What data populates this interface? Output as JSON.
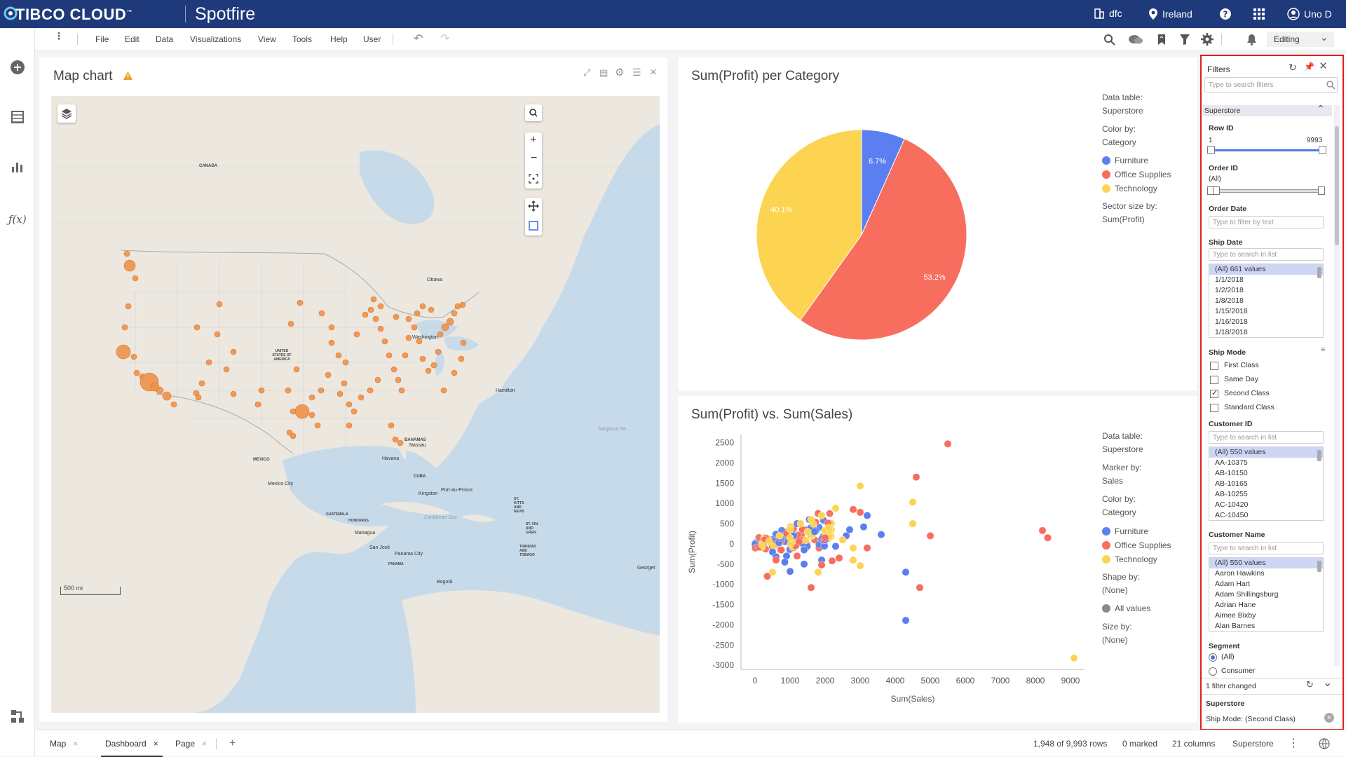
{
  "topbar": {
    "brand": "TIBCO CLOUD",
    "brand_mark": "™",
    "app": "Spotfire",
    "org": "dfc",
    "region": "Ireland",
    "user": "Uno D"
  },
  "menu": {
    "items": [
      "File",
      "Edit",
      "Data",
      "Visualizations",
      "View",
      "Tools",
      "Help",
      "User"
    ],
    "mode": "Editing"
  },
  "map": {
    "title": "Map chart",
    "scale_label": "500 mi",
    "places": [
      "CANADA",
      "UNITED STATES OF AMERICA",
      "MEXICO",
      "Ottawa",
      "Washington",
      "Hamilton",
      "Sargasso Se",
      "BAHAMAS",
      "Nassau",
      "Havana",
      "CUBA",
      "Port-au-Prince",
      "Kingston",
      "Mexico City",
      "GUATEMALA",
      "HONDURAS",
      "Managua",
      "San José",
      "PANAMA",
      "Panama City",
      "Caribbean Sea",
      "Bogotá",
      "Georget",
      "ST. KITTS AND NEVIS",
      "ST. VIN. AND GREN.",
      "TRINIDAD AND TOBAGO"
    ]
  },
  "pie": {
    "title": "Sum(Profit) per Category",
    "legend": {
      "data_table_label": "Data table:",
      "data_table": "Superstore",
      "color_by_label": "Color by:",
      "color_by": "Category",
      "sector_label": "Sector size by:",
      "sector": "Sum(Profit)"
    }
  },
  "scatter": {
    "title": "Sum(Profit) vs. Sum(Sales)",
    "legend": {
      "data_table_label": "Data table:",
      "data_table": "Superstore",
      "marker_label": "Marker by:",
      "marker": "Sales",
      "color_by_label": "Color by:",
      "color_by": "Category",
      "shape_label": "Shape by:",
      "shape": "(None)",
      "shape_item": "All values",
      "size_label": "Size by:",
      "size": "(None)"
    }
  },
  "chart_data": [
    {
      "type": "pie",
      "title": "Sum(Profit) per Category",
      "categories": [
        "Furniture",
        "Office Supplies",
        "Technology"
      ],
      "values": [
        6.7,
        53.2,
        40.1
      ],
      "labels": [
        "6.7%",
        "53.2%",
        "40.1%"
      ],
      "colors": [
        "#5b7ff0",
        "#f76d5e",
        "#fdd451"
      ],
      "legend": "right"
    },
    {
      "type": "scatter",
      "title": "Sum(Profit) vs. Sum(Sales)",
      "xlabel": "Sum(Sales)",
      "ylabel": "Sum(Profit)",
      "xlim": [
        -400,
        9400
      ],
      "ylim": [
        -3100,
        2700
      ],
      "xticks": [
        0,
        1000,
        2000,
        3000,
        4000,
        5000,
        6000,
        7000,
        8000,
        9000
      ],
      "yticks": [
        2500,
        2000,
        1500,
        1000,
        500,
        0,
        -500,
        -1000,
        -1500,
        -2000,
        -2500,
        -3000
      ],
      "series": [
        {
          "name": "Furniture",
          "color": "#5b7ff0",
          "points": [
            [
              100,
              -50
            ],
            [
              300,
              80
            ],
            [
              500,
              -200
            ],
            [
              700,
              150
            ],
            [
              900,
              -300
            ],
            [
              1100,
              200
            ],
            [
              1400,
              -150
            ],
            [
              1700,
              300
            ],
            [
              2000,
              100
            ],
            [
              2300,
              -60
            ],
            [
              2700,
              350
            ],
            [
              3100,
              420
            ],
            [
              3600,
              230
            ],
            [
              4300,
              -700
            ],
            [
              4500,
              500
            ],
            [
              4300,
              -1890
            ],
            [
              850,
              -450
            ],
            [
              1400,
              -500
            ],
            [
              1900,
              -400
            ],
            [
              1000,
              -680
            ],
            [
              3200,
              700
            ],
            [
              2600,
              200
            ],
            [
              1550,
              600
            ],
            [
              600,
              -320
            ],
            [
              1200,
              500
            ]
          ]
        },
        {
          "name": "Office Supplies",
          "color": "#f76d5e",
          "points": [
            [
              120,
              -80
            ],
            [
              280,
              100
            ],
            [
              600,
              -400
            ],
            [
              900,
              250
            ],
            [
              1200,
              -300
            ],
            [
              1600,
              -1080
            ],
            [
              2800,
              850
            ],
            [
              3000,
              780
            ],
            [
              4600,
              1650
            ],
            [
              5500,
              2470
            ],
            [
              5000,
              200
            ],
            [
              4700,
              -1080
            ],
            [
              8200,
              330
            ],
            [
              8350,
              150
            ],
            [
              1800,
              750
            ],
            [
              2000,
              150
            ],
            [
              2400,
              -350
            ],
            [
              3200,
              -100
            ],
            [
              350,
              -800
            ],
            [
              750,
              -150
            ],
            [
              1350,
              350
            ],
            [
              1900,
              -520
            ],
            [
              2200,
              -420
            ]
          ]
        },
        {
          "name": "Technology",
          "color": "#fdd451",
          "points": [
            [
              200,
              -30
            ],
            [
              400,
              60
            ],
            [
              700,
              200
            ],
            [
              1000,
              350
            ],
            [
              1300,
              500
            ],
            [
              1600,
              600
            ],
            [
              1900,
              700
            ],
            [
              2300,
              880
            ],
            [
              3000,
              1430
            ],
            [
              4500,
              1030
            ],
            [
              4500,
              500
            ],
            [
              3000,
              -540
            ],
            [
              2800,
              -400
            ],
            [
              9100,
              -2820
            ],
            [
              500,
              -700
            ],
            [
              1000,
              150
            ],
            [
              1500,
              300
            ],
            [
              2100,
              400
            ],
            [
              2500,
              100
            ],
            [
              1800,
              -700
            ],
            [
              2800,
              -100
            ]
          ]
        }
      ]
    }
  ],
  "filters": {
    "title": "Filters",
    "search_placeholder": "Type to search filters",
    "table_name": "Superstore",
    "row_id": {
      "label": "Row ID",
      "min": "1",
      "max": "9993"
    },
    "order_id": {
      "label": "Order ID",
      "value": "(All)"
    },
    "order_date": {
      "label": "Order Date",
      "placeholder": "Type to filter by text"
    },
    "ship_date": {
      "label": "Ship Date",
      "placeholder": "Type to search in list",
      "items": [
        "(All) 661 values",
        "1/1/2018",
        "1/2/2018",
        "1/8/2018",
        "1/15/2018",
        "1/16/2018",
        "1/18/2018"
      ]
    },
    "ship_mode": {
      "label": "Ship Mode",
      "options": [
        {
          "label": "First Class",
          "checked": false
        },
        {
          "label": "Same Day",
          "checked": false
        },
        {
          "label": "Second Class",
          "checked": true
        },
        {
          "label": "Standard Class",
          "checked": false
        }
      ]
    },
    "customer_id": {
      "label": "Customer ID",
      "placeholder": "Type to search in list",
      "items": [
        "(All) 550 values",
        "AA-10375",
        "AB-10150",
        "AB-10165",
        "AB-10255",
        "AC-10420",
        "AC-10450"
      ]
    },
    "customer_name": {
      "label": "Customer Name",
      "placeholder": "Type to search in list",
      "items": [
        "(All) 550 values",
        "Aaron Hawkins",
        "Adam Hart",
        "Adam Shillingsburg",
        "Adrian Hane",
        "Aimee Bixby",
        "Alan Barnes"
      ]
    },
    "segment": {
      "label": "Segment",
      "options": [
        "(All)",
        "Consumer"
      ]
    },
    "changed": "1 filter changed",
    "summary_table": "Superstore",
    "summary_filter": "Ship Mode: (Second Class)"
  },
  "tabs": [
    "Map",
    "Dashboard",
    "Page"
  ],
  "status": {
    "rows": "1,948 of 9,993 rows",
    "marked": "0 marked",
    "columns": "21 columns",
    "table": "Superstore"
  }
}
